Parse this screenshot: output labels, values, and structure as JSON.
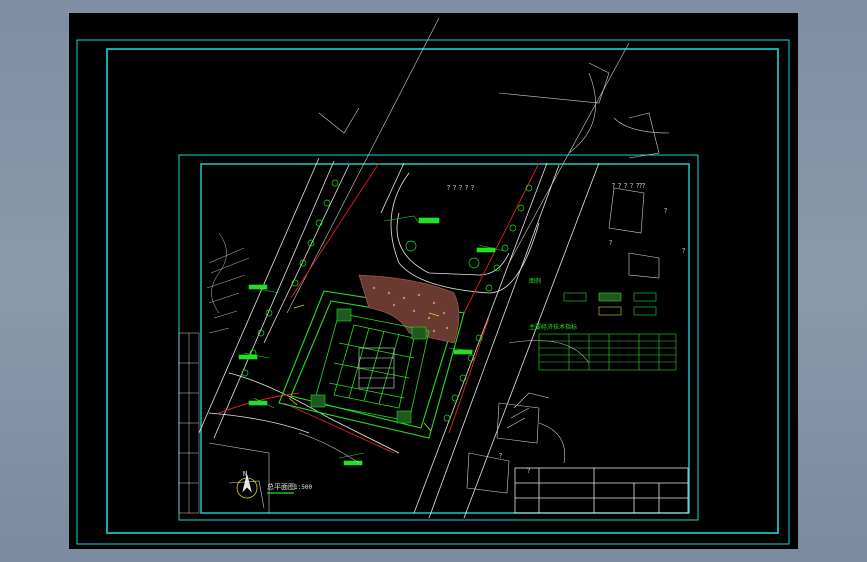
{
  "drawing": {
    "title_main": "总平面图",
    "scale": "1:500",
    "north_label": "N",
    "legend_title": "图例",
    "table_title": "主要经济技术指标",
    "road_labels": [
      "？？？？？",
      "？？？？？？",
      "？？？？？"
    ],
    "question_marks": [
      "？",
      "？",
      "？",
      "？",
      "？",
      "？"
    ],
    "table_rows": 5,
    "table_cols": 6,
    "titleblock_rows": 3,
    "titleblock_cols": 5
  },
  "colors": {
    "frame": "#18d7d7",
    "lines": "#e6e6e6",
    "green": "#22e022",
    "red": "#e02020",
    "brown": "#9e6a5a",
    "yellow": "#e0d020"
  }
}
